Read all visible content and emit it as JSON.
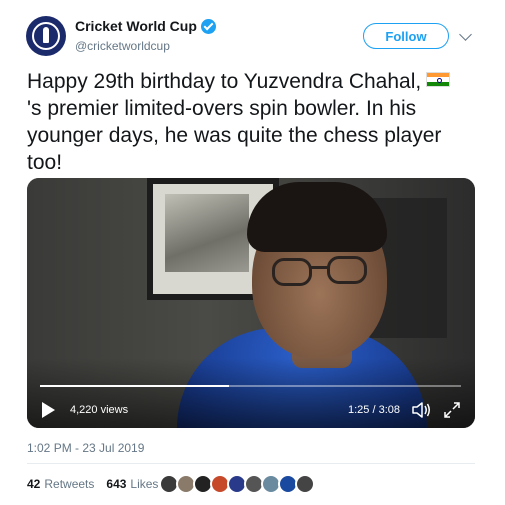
{
  "account": {
    "display_name": "Cricket World Cup",
    "handle": "@cricketworldcup",
    "avatar_icon": "cricket-world-cup-logo",
    "verified_icon": "verified-badge-icon"
  },
  "actions": {
    "follow_label": "Follow",
    "more_icon": "chevron-down-icon"
  },
  "tweet": {
    "text_part1": "Happy 29th birthday to Yuzvendra Chahal,",
    "flag_icon": "india-flag-icon",
    "text_part2": "'s premier limited-overs spin bowler. In his younger days, he was quite the chess player too!"
  },
  "video": {
    "views": "4,220 views",
    "time": "1:25 / 3:08",
    "progress": 0.45,
    "play_icon": "play-icon",
    "volume_icon": "volume-icon",
    "fullscreen_icon": "fullscreen-icon"
  },
  "meta": {
    "timestamp": "1:02 PM - 23 Jul 2019"
  },
  "stats": {
    "retweets_count": "42",
    "retweets_label": "Retweets",
    "likes_count": "643",
    "likes_label": "Likes",
    "liker_colors": [
      "#3a3a3a",
      "#8a7a6a",
      "#222222",
      "#c64a2a",
      "#2a3a8a",
      "#555555",
      "#6a8aa0",
      "#1a4aa0",
      "#444444"
    ]
  }
}
